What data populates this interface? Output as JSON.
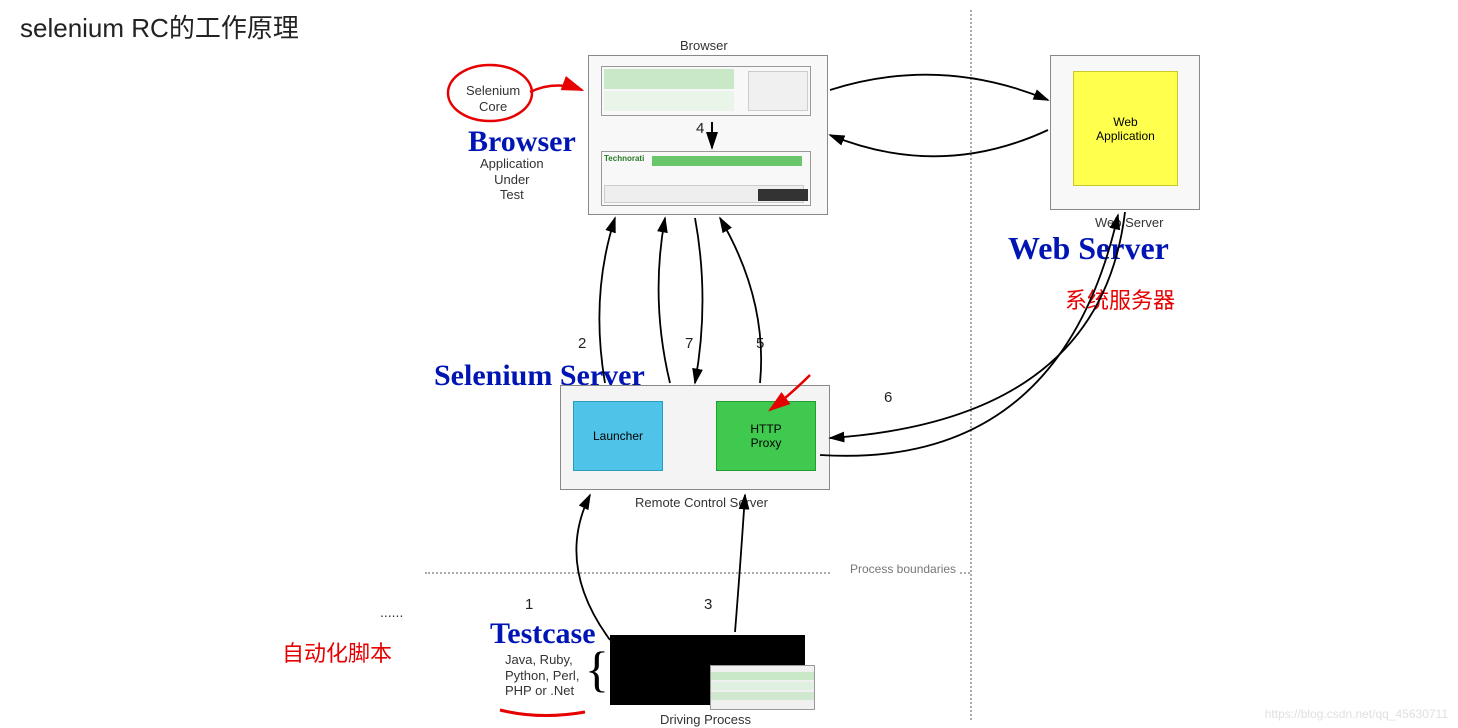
{
  "title": "selenium RC的工作原理",
  "labels": {
    "browser": "Browser",
    "browser_big": "Browser",
    "selenium_core": "Selenium\nCore",
    "aut": "Application\nUnder\nTest",
    "selenium_server": "Selenium Server",
    "launcher": "Launcher",
    "http_proxy": "HTTP\nProxy",
    "rc_server": "Remote Control Server",
    "testcase": "Testcase",
    "languages": "Java, Ruby,\nPython, Perl,\nPHP or .Net",
    "driving_process": "Driving Process",
    "web_server_big": "Web Server",
    "web_server": "Web Server",
    "web_app": "Web\nApplication",
    "process_boundaries": "Process boundaries"
  },
  "annotations": {
    "auto_script": "自动化脚本",
    "system_server": "系统服务器"
  },
  "numbers": {
    "n1": "1",
    "n2": "2",
    "n3": "3",
    "n4": "4",
    "n5": "5",
    "n6": "6",
    "n7": "7"
  },
  "watermark_faint": "https://blog.csdn.net/qq_45630711",
  "dots": "......",
  "technorati": "Technorati"
}
